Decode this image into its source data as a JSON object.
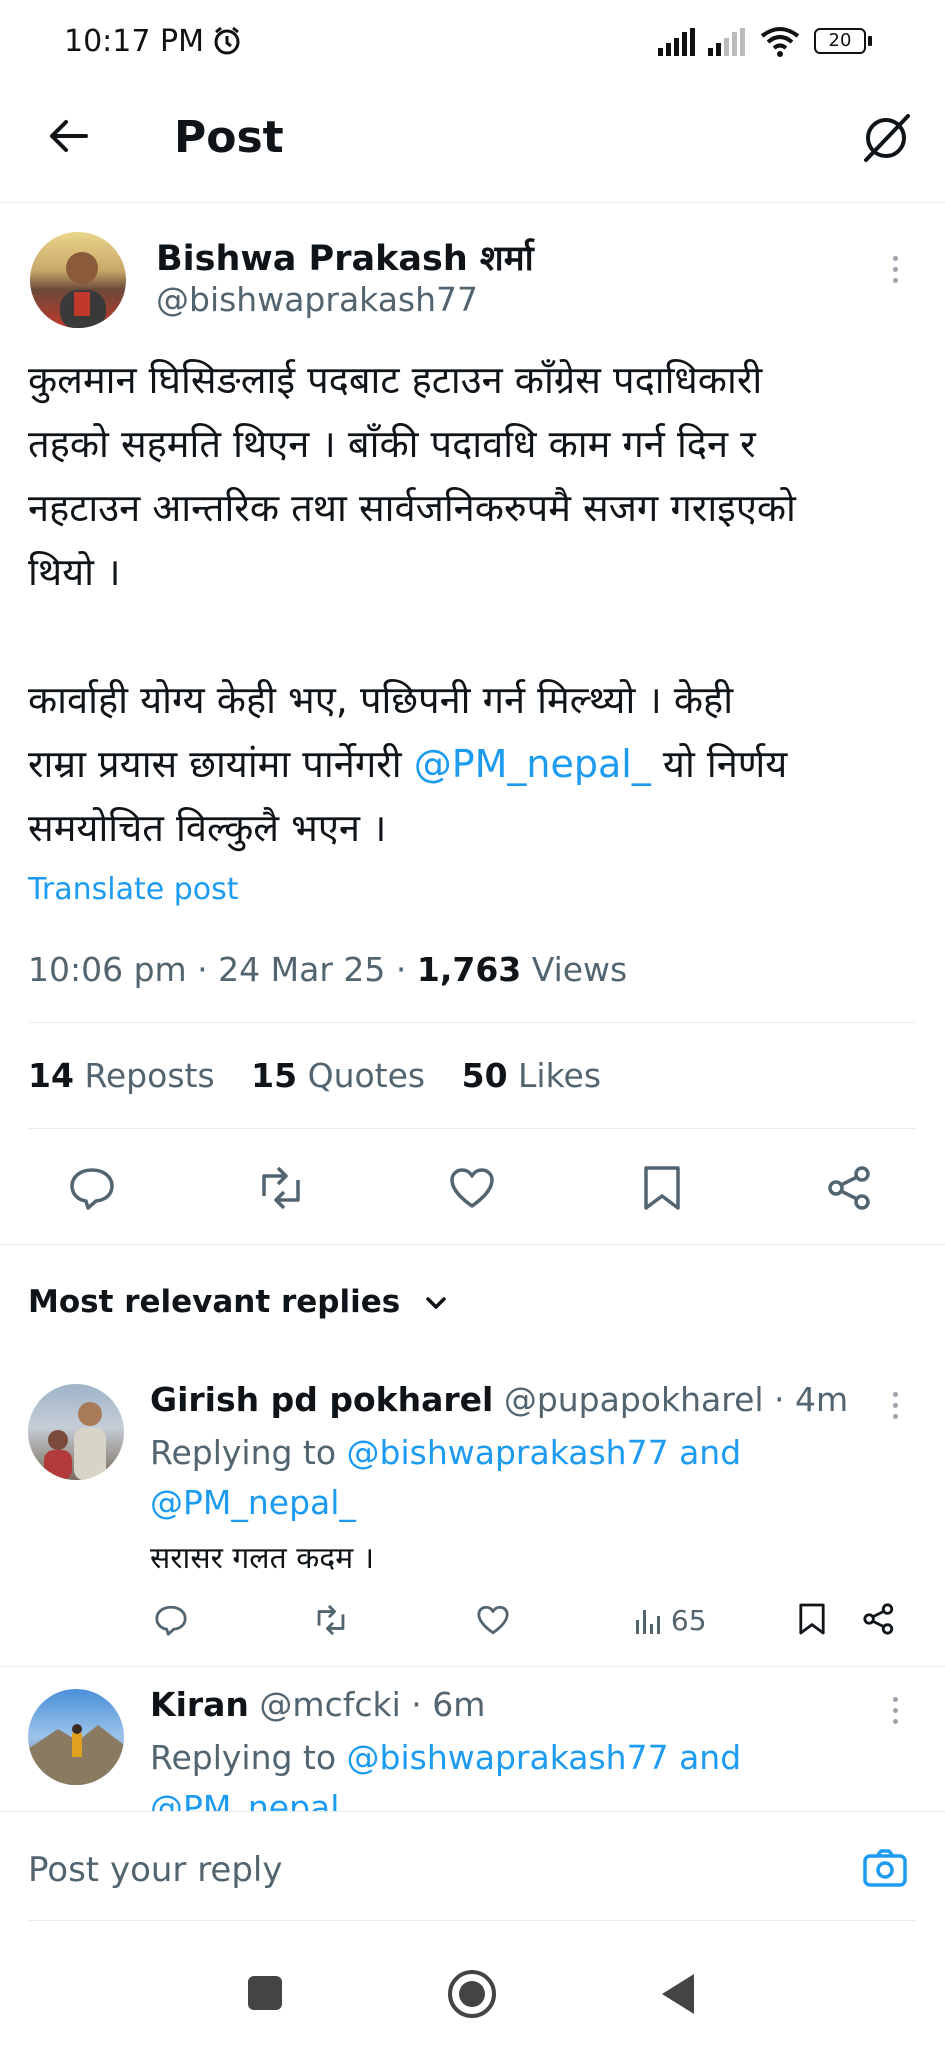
{
  "status_bar": {
    "time": "10:17 PM",
    "battery": "20"
  },
  "header": {
    "title": "Post"
  },
  "post": {
    "author_name": "Bishwa Prakash शर्मा",
    "author_handle": "@bishwaprakash77",
    "text_lines": [
      "कुलमान घिसिङलाई पदबाट हटाउन काँग्रेस पदाधिकारी",
      "तहको सहमति थिएन । बाँकी पदावधि काम गर्न दिन र",
      "नहटाउन आन्तरिक तथा सार्वजनिकरुपमै सजग गराइएको",
      "थियो ।"
    ],
    "text_lines2_1": "कार्वाही योग्य केही भए, पछिपनी गर्न मिल्थ्यो । केही",
    "text_lines2_2_pre": "राम्रा प्रयास छायांमा पार्नेगरी ",
    "text_lines2_2_mention": "@PM_nepal_",
    "text_lines2_2_post": " यो निर्णय",
    "text_lines2_3": "समयोचित विल्कुलै भएन ।",
    "translate": "Translate post",
    "time": "10:06 pm · 24 Mar 25 · ",
    "views_count": "1,763",
    "views_label": " Views",
    "reposts_count": "14",
    "reposts_label": "Reposts",
    "quotes_count": "15",
    "quotes_label": "Quotes",
    "likes_count": "50",
    "likes_label": "Likes"
  },
  "replies_filter": {
    "label": "Most relevant replies"
  },
  "replies": [
    {
      "name": "Girish pd pokharel",
      "handle": "@pupapokharel · 4m",
      "replying_prefix": "Replying to ",
      "replying_1": "@bishwaprakash77",
      "replying_and": " and",
      "replying_2": "@PM_nepal_",
      "text": "सरासर गलत कदम ।",
      "views": "65"
    },
    {
      "name": "Kiran",
      "handle": "@mcfcki · 6m",
      "replying_prefix": "Replying to ",
      "replying_1": "@bishwaprakash77",
      "replying_and": " and",
      "replying_2": "@PM_nepal_"
    }
  ],
  "composer": {
    "placeholder": "Post your reply"
  },
  "icons": {
    "back": "back-arrow-icon",
    "grok": "grok-icon",
    "more": "more-icon",
    "reply": "reply-icon",
    "repost": "repost-icon",
    "like": "like-icon",
    "bookmark": "bookmark-icon",
    "share": "share-icon",
    "camera": "camera-icon"
  },
  "colors": {
    "accent": "#1d9bf0",
    "text": "#0f1419",
    "muted": "#536471"
  }
}
